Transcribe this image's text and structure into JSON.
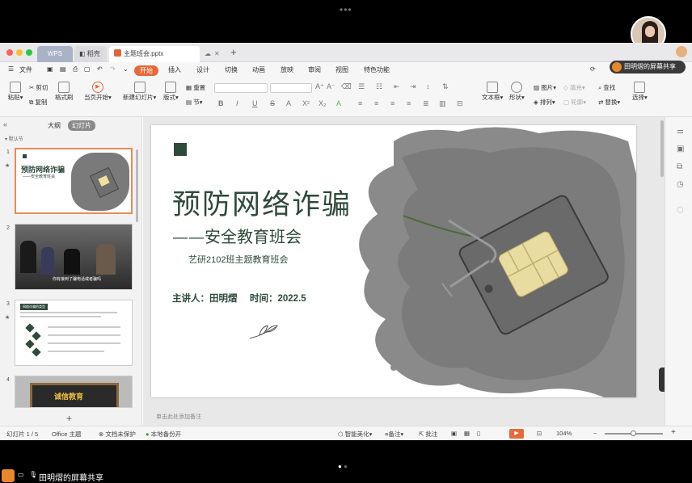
{
  "app": {
    "tabs": [
      {
        "label": "WPS"
      },
      {
        "label": "稻壳"
      },
      {
        "label": "主题班会.pptx"
      }
    ],
    "menu": [
      "文件",
      "开始",
      "插入",
      "设计",
      "切换",
      "动画",
      "放映",
      "审阅",
      "视图",
      "特色功能"
    ],
    "ribbon": {
      "paste": "粘贴",
      "cut": "剪切",
      "copy": "复制",
      "format_painter": "格式刷",
      "play_from_current": "当页开始",
      "new_slide": "新建幻灯片",
      "layout": "版式",
      "reset": "重置",
      "section": "节",
      "textbox": "文本框",
      "shape": "形状",
      "picture": "图片",
      "arrange": "排列",
      "fill": "填充",
      "outline": "轮廓",
      "find": "查找",
      "replace": "替换",
      "select": "选择"
    }
  },
  "share": {
    "label": "田明熠的屏幕共享",
    "bottom_label": "田明熠的屏幕共享"
  },
  "leftpanel": {
    "tab_outline": "大纲",
    "tab_slides": "幻灯片",
    "section_label": "默认节",
    "slides": [
      {
        "num": "1",
        "title": "预防网络诈骗",
        "subtitle": "——安全教育班会"
      },
      {
        "num": "2",
        "caption": "你有接到了骗电话或者骗吗"
      },
      {
        "num": "3",
        "title": "网络诈骗的类型"
      },
      {
        "num": "4",
        "title": "诚信教育"
      }
    ]
  },
  "slide": {
    "title": "预防网络诈骗",
    "subtitle": "——安全教育班会",
    "class_line": "艺研2102班主题教育班会",
    "presenter": "主讲人：田明熠",
    "time": "时间：2022.5"
  },
  "notes_placeholder": "单击此处添加备注",
  "status": {
    "slide_counter": "幻灯片 1 / 5",
    "theme": "Office 主题",
    "doc_protect": "文档未保护",
    "backup": "本地备份开",
    "beautify": "智能美化",
    "notes": "备注",
    "comments": "批注",
    "zoom": "104%"
  },
  "colors": {
    "accent": "#e86a3a",
    "title_green": "#2e4a3a",
    "wps_tab": "#a9b3c7"
  }
}
